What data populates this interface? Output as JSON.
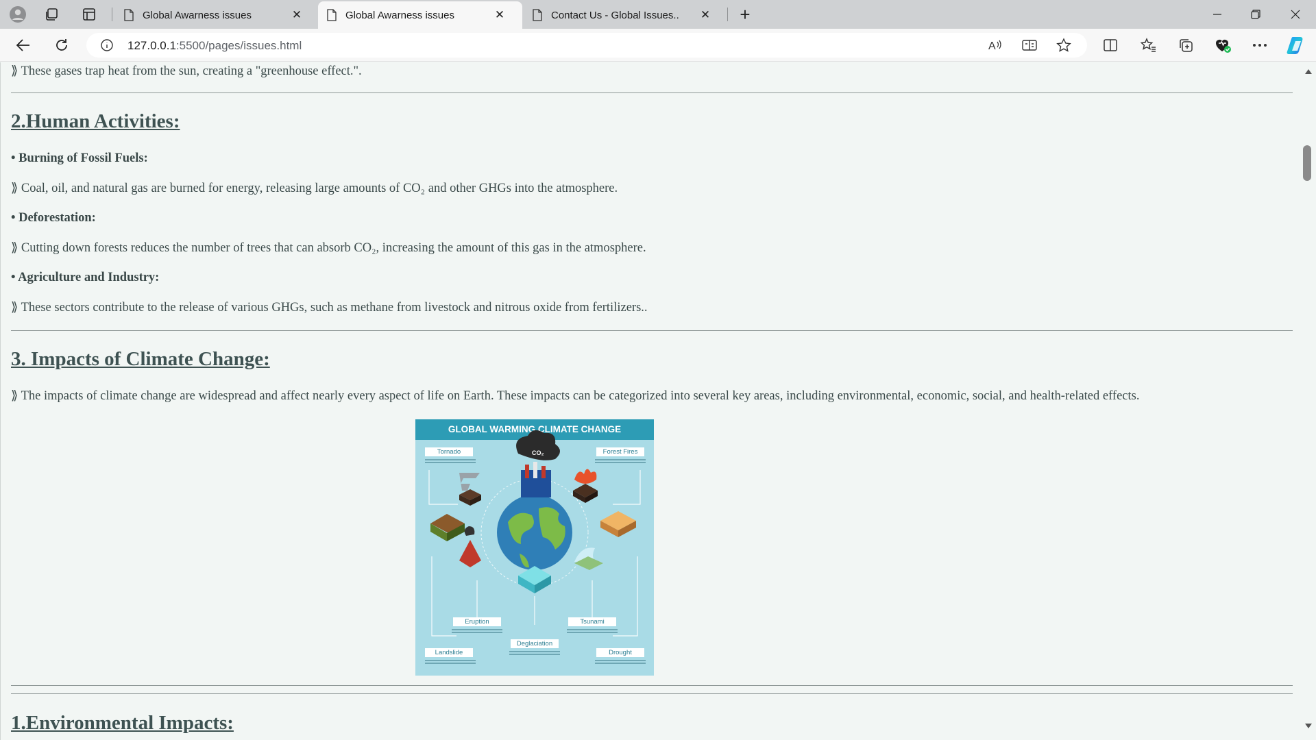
{
  "browser": {
    "tabs": [
      {
        "title": "Global Awarness issues",
        "active": false
      },
      {
        "title": "Global Awarness issues",
        "active": true
      },
      {
        "title": "Contact Us - Global Issues..",
        "active": false
      }
    ],
    "new_tab_symbol": "+",
    "close_symbol": "✕",
    "address": {
      "host": "127.0.0.1",
      "port_path": ":5500/pages/issues.html"
    },
    "icons": [
      "profile-icon",
      "workspaces-icon",
      "tab-actions-icon",
      "back-icon",
      "refresh-icon",
      "site-info-icon",
      "read-aloud-icon",
      "immersive-reader-icon",
      "favorite-star-icon",
      "split-screen-icon",
      "favorites-icon",
      "collections-icon",
      "browser-essentials-icon",
      "more-icon",
      "copilot-icon"
    ]
  },
  "page": {
    "greenhouse_line": "⟫ These gases trap heat from the sun, creating a \"greenhouse effect.\".",
    "human_heading": "2.Human Activities:",
    "fossil_title": "• Burning of Fossil Fuels:",
    "fossil_text": "⟫ Coal, oil, and natural gas are burned for energy, releasing large amounts of CO₂ and other GHGs into the atmosphere.",
    "deforest_title": "• Deforestation:",
    "deforest_text": "⟫ Cutting down forests reduces the number of trees that can absorb CO₂, increasing the amount of this gas in the atmosphere.",
    "agri_title": "• Agriculture and Industry:",
    "agri_text": "⟫ These sectors contribute to the release of various GHGs, such as methane from livestock and nitrous oxide from fertilizers..",
    "impacts_heading": "3. Impacts of Climate Change:",
    "impacts_text": "⟫ The impacts of climate change are widespread and affect nearly every aspect of life on Earth. These impacts can be categorized into several key areas, including environmental, economic, social, and health-related effects.",
    "env_heading": "1.Environmental Impacts:"
  },
  "infographic": {
    "title": "GLOBAL WARMING CLIMATE CHANGE",
    "co2": "CO₂",
    "labels": {
      "tornado": "Tornado",
      "forest_fires": "Forest Fires",
      "eruption": "Eruption",
      "tsunami": "Tsunami",
      "landslide": "Landslide",
      "deglaciation": "Deglaciation",
      "drought": "Drought"
    }
  },
  "colors": {
    "page_bg": "#f2f6f4",
    "heading": "#3e5252",
    "infographic_bg": "#a9dbe6",
    "infographic_header": "#2d9cb5"
  }
}
